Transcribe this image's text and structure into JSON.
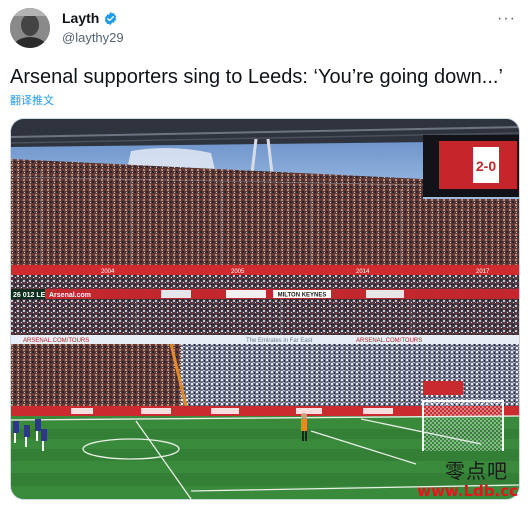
{
  "tweet": {
    "display_name": "Layth",
    "handle": "@laythy29",
    "verified": true,
    "more_menu": "···",
    "text": "Arsenal supporters sing to Leeds: ‘You’re going down...’",
    "translate_label": "翻译推文"
  },
  "photo": {
    "scoreboard_score": "2-0",
    "ring_years": [
      "2004",
      "2005",
      "2014",
      "2017"
    ],
    "ad_board_texts": [
      "Arsenal.com",
      "MILTON KEYNES"
    ],
    "lower_band_texts": [
      "ARSENAL.COM/TOURS",
      "The Emirates in Far East",
      "ARSENAL.COM/TOURS"
    ],
    "side_clock": "26 012 LE"
  },
  "watermark": {
    "chinese": "零点吧",
    "url": "www.Ldb.cc"
  },
  "colors": {
    "verified_blue": "#1d9bf0",
    "arsenal_red": "#d8242b",
    "pitch_green": "#3a8a3c",
    "watermark_red": "#e3151b"
  }
}
